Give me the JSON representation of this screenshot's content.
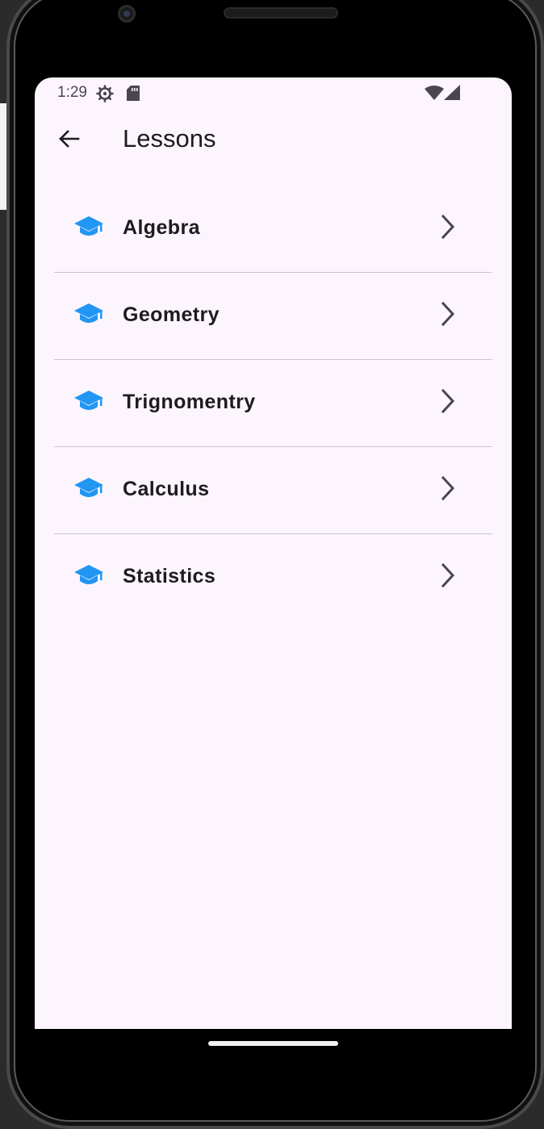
{
  "status_bar": {
    "time": "1:29",
    "icons": [
      "settings-gear-icon",
      "sd-card-icon",
      "wifi-icon",
      "cell-signal-icon"
    ]
  },
  "app_bar": {
    "back_icon": "arrow-back-icon",
    "title": "Lessons"
  },
  "lessons": [
    {
      "label": "Algebra",
      "icon": "graduation-cap-icon",
      "trailing_icon": "chevron-right-icon"
    },
    {
      "label": "Geometry",
      "icon": "graduation-cap-icon",
      "trailing_icon": "chevron-right-icon"
    },
    {
      "label": "Trignomentry",
      "icon": "graduation-cap-icon",
      "trailing_icon": "chevron-right-icon"
    },
    {
      "label": "Calculus",
      "icon": "graduation-cap-icon",
      "trailing_icon": "chevron-right-icon"
    },
    {
      "label": "Statistics",
      "icon": "graduation-cap-icon",
      "trailing_icon": "chevron-right-icon"
    }
  ],
  "colors": {
    "accent": "#2196f3",
    "background": "#fcf5fd",
    "text": "#1d1b20",
    "divider": "#cac4d0",
    "chevron": "#49454f"
  }
}
